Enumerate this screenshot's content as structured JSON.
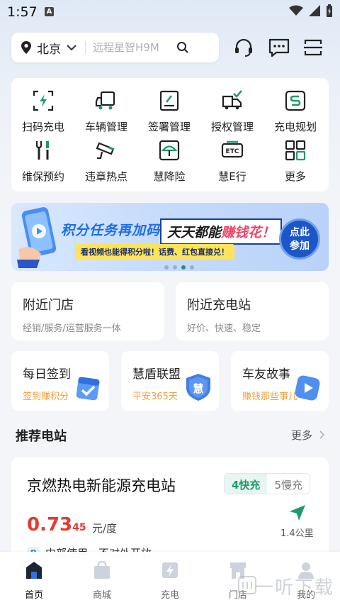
{
  "status_bar": {
    "time": "1:57",
    "badge": "A"
  },
  "search": {
    "city": "北京",
    "placeholder": "远程星智H9M"
  },
  "quick_menu": [
    {
      "label": "扫码充电",
      "icon": "scan-charge-icon"
    },
    {
      "label": "车辆管理",
      "icon": "truck-icon"
    },
    {
      "label": "签署管理",
      "icon": "sign-icon"
    },
    {
      "label": "授权管理",
      "icon": "authorize-truck-icon"
    },
    {
      "label": "充电规划",
      "icon": "route-plan-icon"
    },
    {
      "label": "维保预约",
      "icon": "wrench-icon"
    },
    {
      "label": "违章热点",
      "icon": "camera-icon"
    },
    {
      "label": "慧降险",
      "icon": "umbrella-icon"
    },
    {
      "label": "慧E行",
      "icon": "etc-icon"
    },
    {
      "label": "更多",
      "icon": "grid-more-icon"
    }
  ],
  "banner": {
    "headline": "积分任务再加码",
    "boxed_prefix": "天天都能",
    "boxed_highlight": "赚钱花！",
    "subline": "看视频也能得积分啦！话费、红包直接兑！",
    "cta_line1": "点此",
    "cta_line2": "参加"
  },
  "nearby": [
    {
      "title": "附近门店",
      "subtitle": "经销/服务/运营服务一体"
    },
    {
      "title": "附近充电站",
      "subtitle": "好价、快速、稳定"
    }
  ],
  "mini_cards": [
    {
      "title": "每日签到",
      "subtitle": "签到赚积分",
      "icon": "calendar-check-icon"
    },
    {
      "title": "慧盾联盟",
      "subtitle": "平安365天",
      "icon": "shield-icon",
      "icon_text": "慧"
    },
    {
      "title": "车友故事",
      "subtitle": "赚钱那些事儿",
      "icon": "video-play-icon"
    }
  ],
  "recommended": {
    "title": "推荐电站",
    "more": "更多"
  },
  "station": {
    "name": "京燃热电新能源充电站",
    "fast": "4快充",
    "slow": "5慢充",
    "price_main": "0.73",
    "price_small": "45",
    "unit": "元/度",
    "distance": "1.4公里",
    "tag_icon": "P",
    "tag_text": "内部使用，不对外开放"
  },
  "tabs": [
    {
      "label": "首页",
      "icon": "home-icon",
      "active": true
    },
    {
      "label": "商城",
      "icon": "shopping-bag-icon",
      "active": false
    },
    {
      "label": "充电",
      "icon": "charge-bolt-icon",
      "active": false
    },
    {
      "label": "门店",
      "icon": "store-icon",
      "active": false
    },
    {
      "label": "我的",
      "icon": "user-icon",
      "active": false
    }
  ],
  "watermark": "一听下载",
  "colors": {
    "accent": "#1f9a6a",
    "price": "#e6392f",
    "orange": "#f0a040",
    "banner_blue": "#1c6ee6"
  }
}
